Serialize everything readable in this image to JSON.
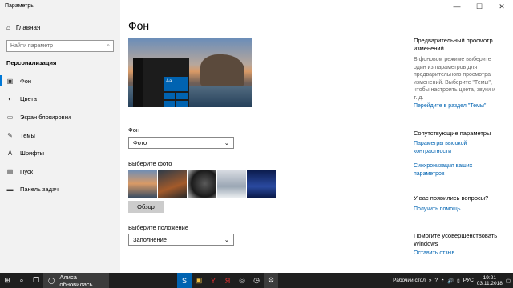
{
  "window": {
    "title": "Параметры",
    "controls": {
      "minimize": "—",
      "maximize": "☐",
      "close": "✕"
    }
  },
  "sidebar": {
    "home_label": "Главная",
    "search_placeholder": "Найти параметр",
    "section_title": "Персонализация",
    "items": [
      {
        "label": "Фон",
        "icon": "image-icon",
        "glyph": "▣"
      },
      {
        "label": "Цвета",
        "icon": "palette-icon",
        "glyph": "◐"
      },
      {
        "label": "Экран блокировки",
        "icon": "lock-screen-icon",
        "glyph": "▭"
      },
      {
        "label": "Темы",
        "icon": "brush-icon",
        "glyph": "✎"
      },
      {
        "label": "Шрифты",
        "icon": "font-icon",
        "glyph": "A"
      },
      {
        "label": "Пуск",
        "icon": "start-icon",
        "glyph": "▤"
      },
      {
        "label": "Панель задач",
        "icon": "taskbar-icon",
        "glyph": "▬"
      }
    ]
  },
  "main": {
    "title": "Фон",
    "preview_tile_text": "Aa",
    "background_label": "Фон",
    "background_value": "Фото",
    "choose_photo_label": "Выберите фото",
    "browse_button": "Обзор",
    "fit_label": "Выберите положение",
    "fit_value": "Заполнение"
  },
  "right_panel": {
    "preview_heading": "Предварительный просмотр изменений",
    "preview_text": "В фоновом режиме выберите один из параметров для предварительного просмотра изменений. Выберите \"Темы\", чтобы настроить цвета, звуки и т. д.",
    "themes_link": "Перейдите в раздел \"Темы\"",
    "related_heading": "Сопутствующие параметры",
    "high_contrast_link": "Параметры высокой контрастности",
    "sync_link": "Синхронизация ваших параметров",
    "questions_heading": "У вас появились вопросы?",
    "help_link": "Получить помощь",
    "improve_heading": "Помогите усовершенствовать Windows",
    "feedback_link": "Оставить отзыв"
  },
  "taskbar": {
    "search_text": "Алиса обновилась",
    "desktop_label": "Рабочий стол",
    "language": "РУС",
    "time": "19:21",
    "date": "03.11.2018",
    "chevron": "»",
    "tray_glyphs": {
      "help": "?",
      "network": "◔",
      "volume": "🔊",
      "speaker": "▯"
    }
  },
  "colors": {
    "accent": "#0078d7",
    "link": "#0063b1",
    "sidebar_bg": "#f2f2f2",
    "taskbar_bg": "#1f1f1f"
  }
}
